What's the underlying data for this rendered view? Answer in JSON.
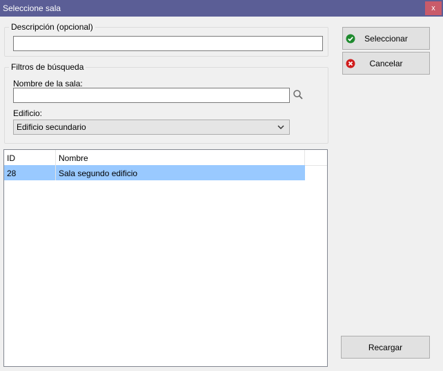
{
  "window": {
    "title": "Seleccione sala",
    "close_label": "x"
  },
  "description_group": {
    "legend": "Descripción (opcional)",
    "value": ""
  },
  "filters_group": {
    "legend": "Filtros de búsqueda",
    "room_name_label": "Nombre de la sala:",
    "room_name_value": "",
    "building_label": "Edificio:",
    "building_selected": "Edificio secundario"
  },
  "buttons": {
    "select_label": "Seleccionar",
    "cancel_label": "Cancelar",
    "reload_label": "Recargar"
  },
  "table": {
    "columns": [
      "ID",
      "Nombre"
    ],
    "rows": [
      {
        "id": "28",
        "name": "Sala segundo edificio",
        "selected": true
      }
    ]
  },
  "colors": {
    "titlebar": "#5b5e96",
    "selected_row": "#99c9ff",
    "ok_icon": "#1e8a2e",
    "cancel_icon": "#d01c1c"
  },
  "icons": {
    "select": "check-circle-icon",
    "cancel": "x-circle-icon",
    "search": "search-icon"
  }
}
